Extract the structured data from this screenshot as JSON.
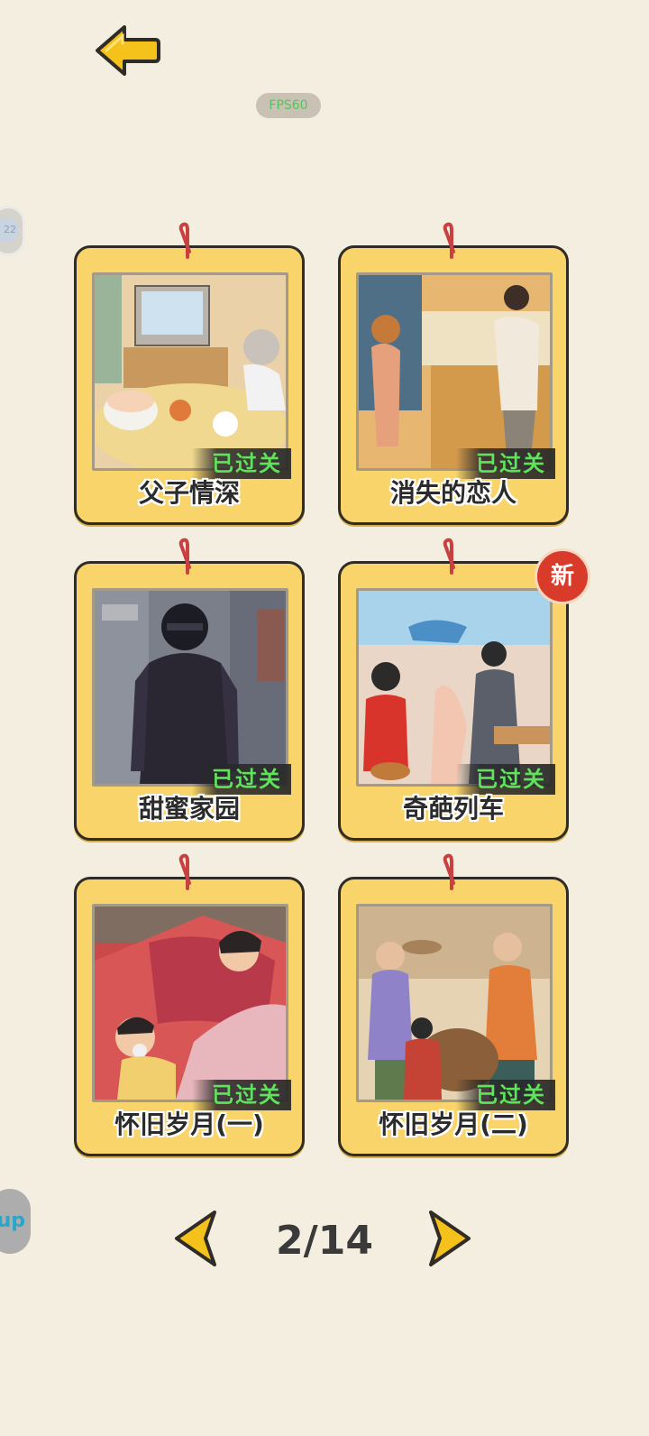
{
  "header": {
    "back_icon": "arrow-left-icon",
    "fps_label": "FPS60"
  },
  "floating": {
    "left_widget_text": "22",
    "up_widget_text": "up"
  },
  "levels": [
    {
      "title": "父子情深",
      "status": "已过关"
    },
    {
      "title": "消失的恋人",
      "status": "已过关"
    },
    {
      "title": "甜蜜家园",
      "status": "已过关"
    },
    {
      "title": "奇葩列车",
      "status": "已过关",
      "badge": "新"
    },
    {
      "title": "怀旧岁月(一)",
      "status": "已过关"
    },
    {
      "title": "怀旧岁月(二)",
      "status": "已过关"
    }
  ],
  "pager": {
    "current_label": "2/14",
    "prev_icon": "chevron-left-icon",
    "next_icon": "chevron-right-icon"
  },
  "colors": {
    "background": "#f3eedf",
    "card": "#f9d46a",
    "passed_text": "#5fe35b",
    "accent": "#f5c21b",
    "badge": "#d93b2a"
  }
}
